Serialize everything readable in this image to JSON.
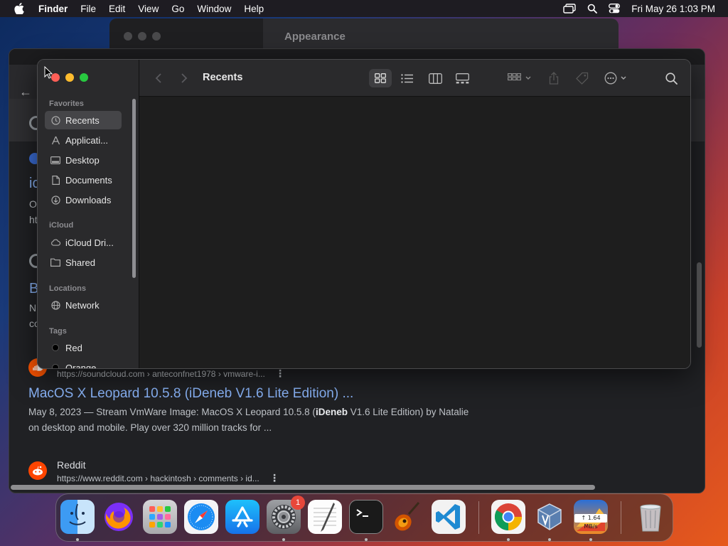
{
  "menubar": {
    "items": [
      "Finder",
      "File",
      "Edit",
      "View",
      "Go",
      "Window",
      "Help"
    ],
    "clock": "Fri May 26  1:03 PM",
    "icons": [
      "apple-logo-icon",
      "screen-mirroring-icon",
      "spotlight-search-icon",
      "control-center-icon"
    ]
  },
  "settings_window": {
    "title": "Appearance"
  },
  "browser": {
    "partial_texts": [
      "ic",
      "O",
      "ht",
      "B",
      "N",
      "co"
    ],
    "results": [
      {
        "url": "https://soundcloud.com › anteconfnet1978 › vmware-i...",
        "title": "MacOS X Leopard 10.5.8 (iDeneb V1.6 Lite Edition) ...",
        "snippet_pre": "May 8, 2023 — Stream VmWare Image: MacOS X Leopard 10.5.8 (",
        "snippet_bold": "iDeneb",
        "snippet_post": " V1.6 Lite Edition) by Natalie on desktop and mobile. Play over 320 million tracks for ..."
      },
      {
        "site": "Reddit",
        "url": "https://www.reddit.com › hackintosh › comments › id..."
      }
    ]
  },
  "finder": {
    "title": "Recents",
    "sidebar": {
      "favorites_label": "Favorites",
      "favorites": [
        {
          "label": "Recents",
          "icon": "clock-icon",
          "selected": true
        },
        {
          "label": "Applicati...",
          "icon": "applications-icon"
        },
        {
          "label": "Desktop",
          "icon": "desktop-icon"
        },
        {
          "label": "Documents",
          "icon": "document-icon"
        },
        {
          "label": "Downloads",
          "icon": "download-icon"
        }
      ],
      "icloud_label": "iCloud",
      "icloud": [
        {
          "label": "iCloud Dri...",
          "icon": "cloud-icon"
        },
        {
          "label": "Shared",
          "icon": "shared-folder-icon"
        }
      ],
      "locations_label": "Locations",
      "locations": [
        {
          "label": "Network",
          "icon": "globe-icon"
        }
      ],
      "tags_label": "Tags",
      "tags": [
        {
          "label": "Red",
          "color": "#000000"
        },
        {
          "label": "Orange",
          "color": "#000000"
        }
      ]
    },
    "toolbar_icons": [
      "back-icon",
      "forward-icon",
      "icon-view-icon",
      "list-view-icon",
      "column-view-icon",
      "gallery-view-icon",
      "group-icon",
      "share-icon",
      "tag-icon",
      "more-icon",
      "search-icon"
    ]
  },
  "dock": {
    "apps": [
      "Finder",
      "Firefox",
      "Launchpad",
      "Safari",
      "App Store",
      "System Settings",
      "TextEdit",
      "Terminal",
      "GarageBand",
      "Visual Studio Code",
      "Google Chrome",
      "VirtualBox",
      "Network Monitor",
      "Trash"
    ],
    "settings_badge": "1",
    "net_speed": "↑ 1.64 MB/s"
  }
}
